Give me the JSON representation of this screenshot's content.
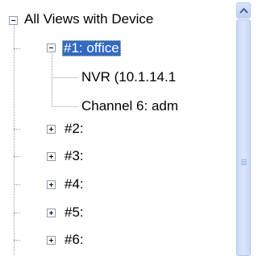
{
  "tree": {
    "root": {
      "label": "All Views with Device",
      "expanded": true
    },
    "views": [
      {
        "label": "#1: office",
        "expanded": true,
        "selected": true,
        "children": [
          "NVR (10.1.14.1",
          "Channel 6: adm"
        ]
      },
      {
        "label": "#2:",
        "expanded": false
      },
      {
        "label": "#3:",
        "expanded": false
      },
      {
        "label": "#4:",
        "expanded": false
      },
      {
        "label": "#5:",
        "expanded": false
      },
      {
        "label": "#6:",
        "expanded": false
      }
    ]
  },
  "colors": {
    "selection": "#316ac5",
    "scrollbar": "#c9d9f8",
    "tree_lines": "#999999"
  },
  "icons": {
    "expanded": "minus-box-icon",
    "collapsed": "plus-box-icon",
    "scroll_up": "chevron-up-icon"
  }
}
